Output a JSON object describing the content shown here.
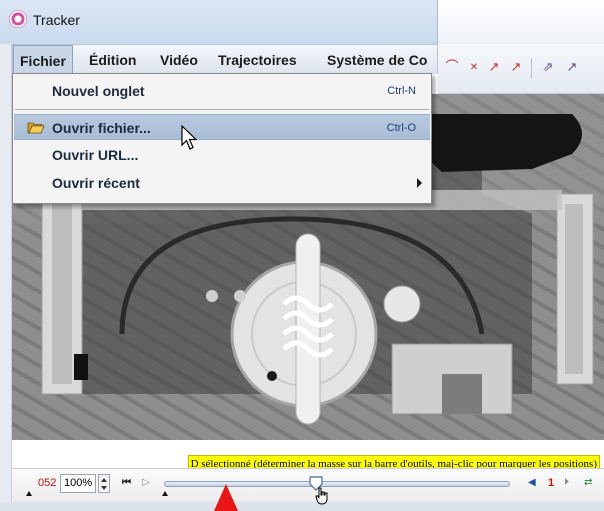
{
  "window": {
    "title": "Tracker"
  },
  "menubar": {
    "items": [
      {
        "label": "Fichier",
        "open": true
      },
      {
        "label": "Édition"
      },
      {
        "label": "Vidéo"
      },
      {
        "label": "Trajectoires"
      },
      {
        "label": "Système de Co"
      }
    ]
  },
  "file_menu": {
    "items": [
      {
        "label": "Nouvel onglet",
        "shortcut": "Ctrl-N"
      },
      {
        "label": "Ouvrir fichier...",
        "shortcut": "Ctrl-O",
        "highlighted": true,
        "icon": "folder-open-icon"
      },
      {
        "label": "Ouvrir URL..."
      },
      {
        "label": "Ouvrir récent",
        "submenu": true
      }
    ]
  },
  "status": {
    "message": "D sélectionné (déterminer la masse sur la barre d'outils, maj-clic pour marquer les positions)"
  },
  "player": {
    "frame_number": "052",
    "zoom": "100%",
    "step_size": "1",
    "slider_position": 0.45
  },
  "colors": {
    "accent_red": "#c01010",
    "status_highlight": "#ffff00",
    "menu_highlight": "#b7c9de"
  }
}
